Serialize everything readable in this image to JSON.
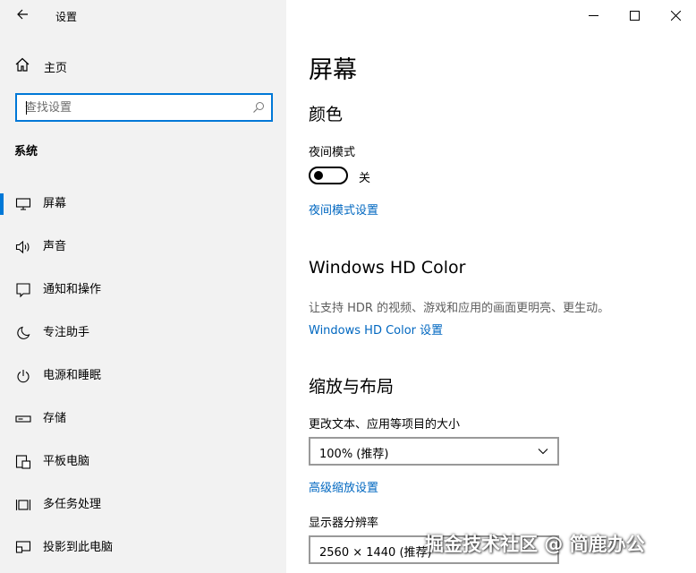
{
  "window": {
    "title": "设置",
    "controls": [
      "minimize-icon",
      "maximize-icon",
      "close-icon"
    ]
  },
  "sidebar": {
    "home_label": "主页",
    "search_placeholder": "查找设置",
    "section_title": "系统",
    "items": [
      {
        "label": "屏幕",
        "icon": "monitor-icon",
        "active": true
      },
      {
        "label": "声音",
        "icon": "speaker-icon"
      },
      {
        "label": "通知和操作",
        "icon": "notification-icon"
      },
      {
        "label": "专注助手",
        "icon": "moon-icon"
      },
      {
        "label": "电源和睡眠",
        "icon": "power-icon"
      },
      {
        "label": "存储",
        "icon": "storage-icon"
      },
      {
        "label": "平板电脑",
        "icon": "tablet-icon"
      },
      {
        "label": "多任务处理",
        "icon": "multitask-icon"
      },
      {
        "label": "投影到此电脑",
        "icon": "project-icon"
      }
    ]
  },
  "main": {
    "title": "屏幕",
    "color": {
      "heading": "颜色",
      "night_mode_label": "夜间模式",
      "night_mode_state": "关",
      "night_mode_on": false,
      "night_mode_link": "夜间模式设置"
    },
    "hdr": {
      "heading": "Windows HD Color",
      "description": "让支持 HDR 的视频、游戏和应用的画面更明亮、更生动。",
      "link": "Windows HD Color 设置"
    },
    "scale": {
      "heading": "缩放与布局",
      "size_label": "更改文本、应用等项目的大小",
      "size_value": "100% (推荐)",
      "advanced_link": "高级缩放设置",
      "resolution_label": "显示器分辨率",
      "resolution_value": "2560 × 1440 (推荐)"
    }
  },
  "watermark": "掘金技术社区 @ 简鹿办公",
  "colors": {
    "accent": "#0078d7",
    "link": "#0067c0",
    "sidebar_bg": "#f2f2f2"
  }
}
